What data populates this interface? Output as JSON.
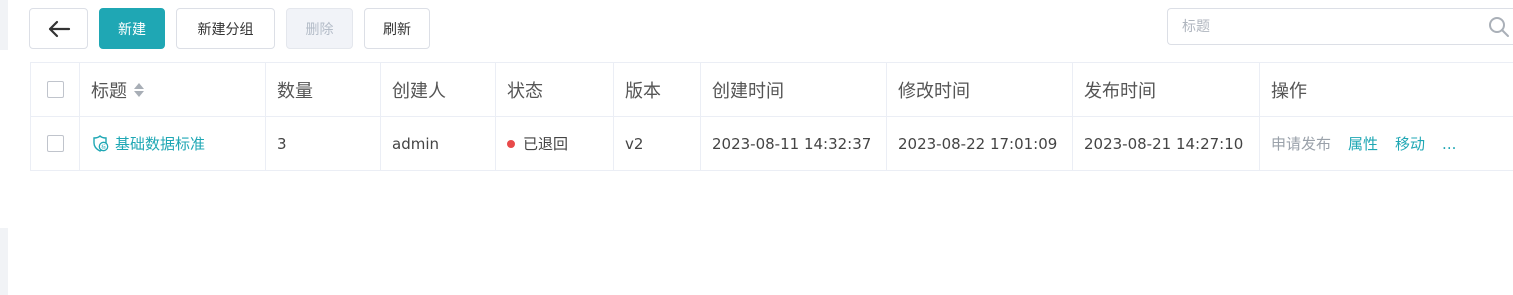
{
  "toolbar": {
    "new_label": "新建",
    "new_group_label": "新建分组",
    "delete_label": "删除",
    "refresh_label": "刷新"
  },
  "search": {
    "placeholder": "标题",
    "value": ""
  },
  "table": {
    "headers": [
      "标题",
      "数量",
      "创建人",
      "状态",
      "版本",
      "创建时间",
      "修改时间",
      "发布时间",
      "操作"
    ],
    "rows": [
      {
        "title": "基础数据标准",
        "count": "3",
        "creator": "admin",
        "status": "已退回",
        "status_color": "#e84a4a",
        "version": "v2",
        "created": "2023-08-11 14:32:37",
        "modified": "2023-08-22 17:01:09",
        "published": "2023-08-21 14:27:10",
        "actions": [
          "申请发布",
          "属性",
          "移动",
          "..."
        ]
      }
    ]
  },
  "colors": {
    "accent": "#1fa7b4",
    "status_returned": "#e84a4a",
    "border": "#ebeef5"
  },
  "icons": {
    "back": "arrow-left-icon",
    "search": "search-icon",
    "sort": "sort-icon",
    "standard": "standard-shield-icon"
  }
}
